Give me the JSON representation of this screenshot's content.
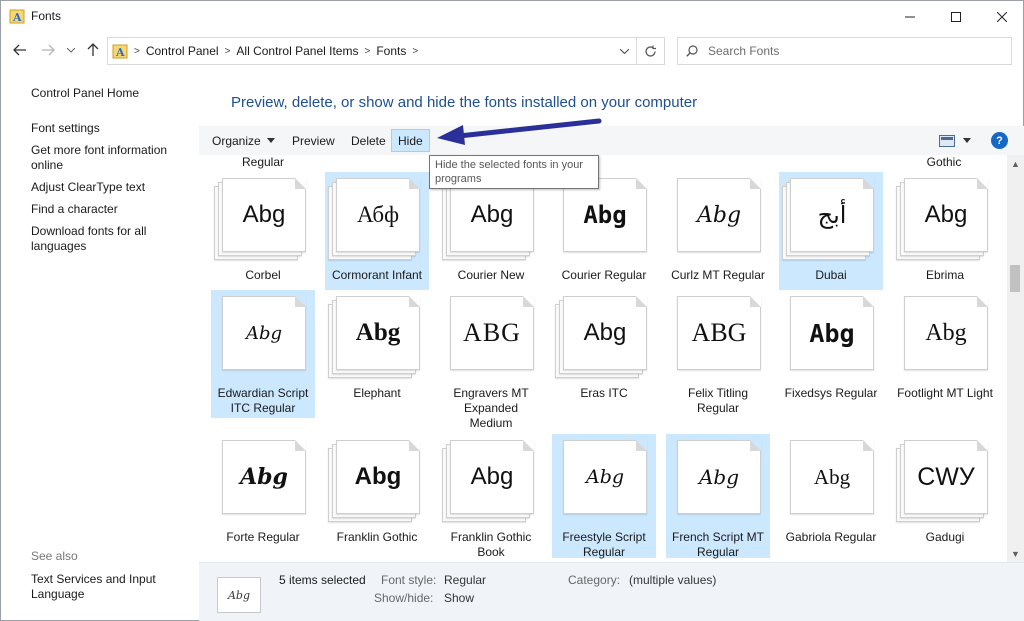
{
  "window": {
    "title": "Fonts",
    "controls": [
      "minimize-icon",
      "maximize-icon",
      "close-icon"
    ]
  },
  "nav": {
    "back_icon": "arrow-left-icon",
    "forward_icon": "arrow-right-icon",
    "recent_icon": "chevron-down-icon",
    "up_icon": "arrow-up-icon",
    "breadcrumbs": [
      "Control Panel",
      "All Control Panel Items",
      "Fonts"
    ],
    "search_placeholder": "Search Fonts"
  },
  "left_pane": {
    "home": "Control Panel Home",
    "links": [
      "Font settings",
      "Get more font information online",
      "Adjust ClearType text",
      "Find a character",
      "Download fonts for all languages"
    ],
    "see_also_label": "See also",
    "see_also_links": [
      "Text Services and Input Language"
    ]
  },
  "main": {
    "headline": "Preview, delete, or show and hide the fonts installed on your computer",
    "toolbar": {
      "organize": "Organize",
      "preview": "Preview",
      "delete": "Delete",
      "hide": "Hide",
      "help": "?"
    },
    "tooltip": "Hide the selected fonts in your programs",
    "top_labels": [
      "Regular",
      "Gothic"
    ],
    "fonts": [
      {
        "name": "Corbel",
        "sample": "Abg",
        "selected": false,
        "stacked": true
      },
      {
        "name": "Cormorant Infant",
        "sample": "Абф",
        "selected": true,
        "stacked": true
      },
      {
        "name": "Courier New",
        "sample": "Abg",
        "selected": false,
        "stacked": true
      },
      {
        "name": "Courier Regular",
        "sample": "Abg",
        "selected": false,
        "stacked": false
      },
      {
        "name": "Curlz MT Regular",
        "sample": "Abg",
        "selected": false,
        "stacked": false
      },
      {
        "name": "Dubai",
        "sample": "أبج",
        "selected": true,
        "stacked": true
      },
      {
        "name": "Ebrima",
        "sample": "Abg",
        "selected": false,
        "stacked": true
      },
      {
        "name": "Edwardian Script ITC Regular",
        "sample": "Abg",
        "selected": true,
        "stacked": false
      },
      {
        "name": "Elephant",
        "sample": "Abg",
        "selected": false,
        "stacked": true
      },
      {
        "name": "Engravers MT Expanded Medium",
        "sample": "ABG",
        "selected": false,
        "stacked": false
      },
      {
        "name": "Eras ITC",
        "sample": "Abg",
        "selected": false,
        "stacked": true
      },
      {
        "name": "Felix Titling Regular",
        "sample": "ABG",
        "selected": false,
        "stacked": false
      },
      {
        "name": "Fixedsys Regular",
        "sample": "Abg",
        "selected": false,
        "stacked": false
      },
      {
        "name": "Footlight MT Light",
        "sample": "Abg",
        "selected": false,
        "stacked": false
      },
      {
        "name": "Forte Regular",
        "sample": "Abg",
        "selected": false,
        "stacked": false
      },
      {
        "name": "Franklin Gothic",
        "sample": "Abg",
        "selected": false,
        "stacked": true
      },
      {
        "name": "Franklin Gothic Book",
        "sample": "Abg",
        "selected": false,
        "stacked": true
      },
      {
        "name": "Freestyle Script Regular",
        "sample": "Abg",
        "selected": true,
        "stacked": false
      },
      {
        "name": "French Script MT Regular",
        "sample": "Abg",
        "selected": true,
        "stacked": false
      },
      {
        "name": "Gabriola Regular",
        "sample": "Abg",
        "selected": false,
        "stacked": false
      },
      {
        "name": "Gadugi",
        "sample": "СWУ",
        "selected": false,
        "stacked": true
      }
    ]
  },
  "details": {
    "count": "5 items selected",
    "font_style_label": "Font style:",
    "font_style_value": "Regular",
    "category_label": "Category:",
    "category_value": "(multiple values)",
    "showhide_label": "Show/hide:",
    "showhide_value": "Show",
    "thumb_sample": "Abg"
  },
  "colors": {
    "selection": "#cce8ff",
    "headline": "#1d4f91",
    "annotation_arrow": "#2b2f9a"
  }
}
